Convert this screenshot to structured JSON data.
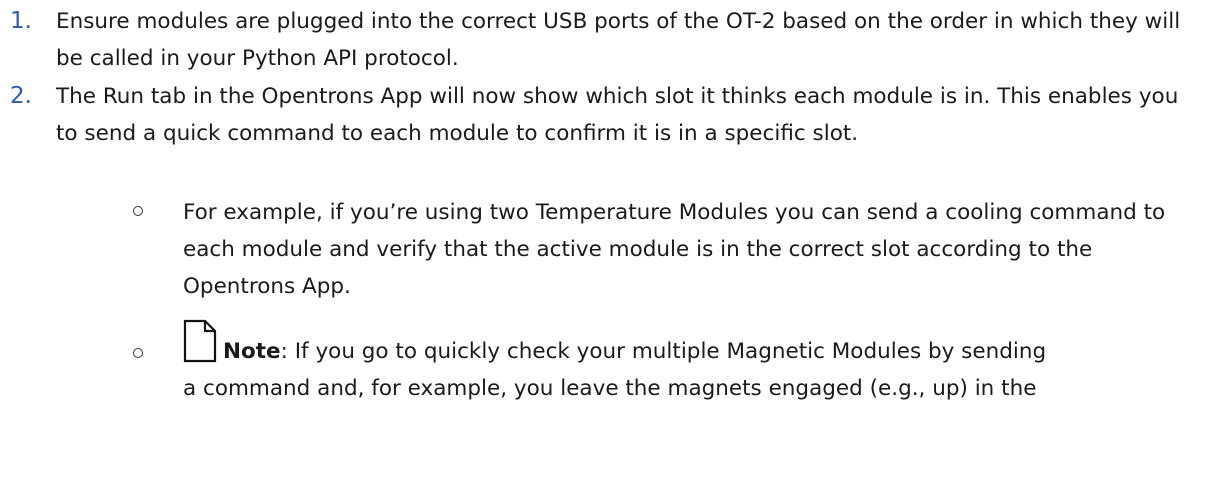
{
  "list": {
    "items": [
      {
        "number": "1.",
        "text": "Ensure modules are plugged into the correct USB ports of the OT-2 based on the order in which they will be called in your Python API protocol."
      },
      {
        "number": "2.",
        "text": "The Run tab in the Opentrons App will now show which slot it thinks each module is in. This enables you to send a quick command to each module to confirm it is in a specific slot."
      }
    ],
    "subitems": [
      {
        "text": "For example, if you’re using two Temperature Modules you can send a cooling command to each module and verify that the active module is in the correct slot according to the Opentrons App."
      },
      {
        "icon": "note-document-icon",
        "label": "Note",
        "text_first_line": ": If you go to quickly check your multiple Magnetic Modules by sending",
        "text_second_line": "a command and, for example, you leave the magnets engaged (e.g., up) in the"
      }
    ]
  },
  "colors": {
    "number_color": "#2e5aa8",
    "text_color": "#1a1a1a"
  }
}
